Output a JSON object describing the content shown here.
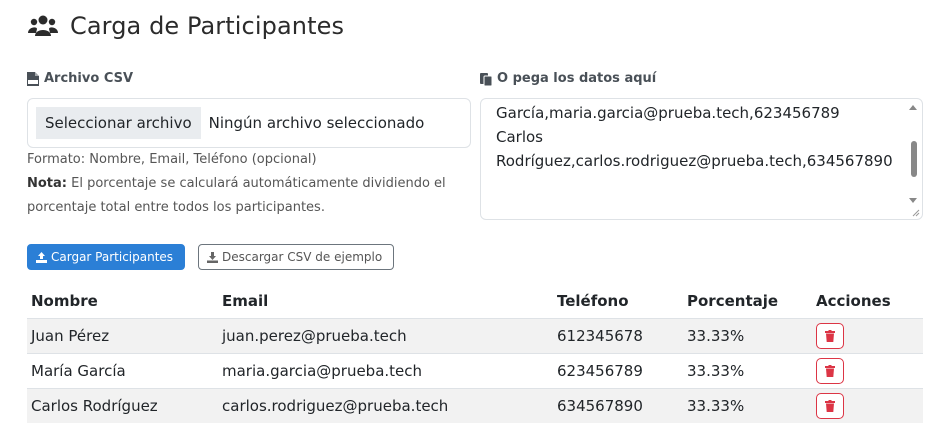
{
  "header": {
    "title": "Carga de Participantes",
    "icon": "users-icon"
  },
  "csv": {
    "label": "Archivo CSV",
    "label_icon": "file-csv-icon",
    "file_button": "Seleccionar archivo",
    "file_status": "Ningún archivo seleccionado",
    "format_text": "Formato: Nombre, Email, Teléfono (opcional)",
    "note_label": "Nota:",
    "note_text": " El porcentaje se calculará automáticamente dividiendo el porcentaje total entre todos los participantes."
  },
  "paste": {
    "label": "O pega los datos aquí",
    "label_icon": "paste-icon",
    "value": "García,maria.garcia@prueba.tech,623456789\nCarlos Rodríguez,carlos.rodriguez@prueba.tech,634567890"
  },
  "buttons": {
    "upload": "Cargar Participantes",
    "upload_icon": "upload-icon",
    "download": "Descargar CSV de ejemplo",
    "download_icon": "download-icon"
  },
  "table": {
    "headers": [
      "Nombre",
      "Email",
      "Teléfono",
      "Porcentaje",
      "Acciones"
    ],
    "rows": [
      [
        "Juan Pérez",
        "juan.perez@prueba.tech",
        "612345678",
        "33.33%"
      ],
      [
        "María García",
        "maria.garcia@prueba.tech",
        "623456789",
        "33.33%"
      ],
      [
        "Carlos Rodríguez",
        "carlos.rodriguez@prueba.tech",
        "634567890",
        "33.33%"
      ]
    ],
    "action_icon": "trash-icon"
  },
  "colors": {
    "primary": "#2b7fd6",
    "danger": "#dc3545",
    "stripe": "#f2f2f2"
  }
}
